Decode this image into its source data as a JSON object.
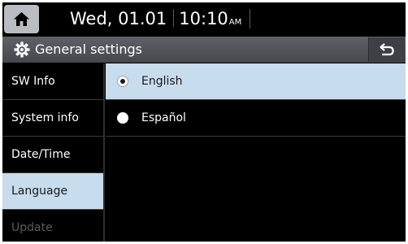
{
  "status_bar": {
    "home_icon": "home-icon",
    "date": "Wed, 01.01",
    "time": "10:10",
    "ampm": "AM"
  },
  "title_bar": {
    "title": "General settings",
    "icon": "gear-icon",
    "back_icon": "back-arrow-icon"
  },
  "sidebar": {
    "items": [
      {
        "label": "SW Info",
        "state": "normal"
      },
      {
        "label": "System info",
        "state": "normal"
      },
      {
        "label": "Date/Time",
        "state": "normal"
      },
      {
        "label": "Language",
        "state": "active"
      },
      {
        "label": "Update",
        "state": "disabled"
      }
    ]
  },
  "language_options": [
    {
      "label": "English",
      "selected": true
    },
    {
      "label": "Español",
      "selected": false
    }
  ],
  "colors": {
    "background": "#000000",
    "highlight": "#c7dced",
    "title_bar": "#55575c",
    "disabled_text": "#5a5a5a"
  }
}
